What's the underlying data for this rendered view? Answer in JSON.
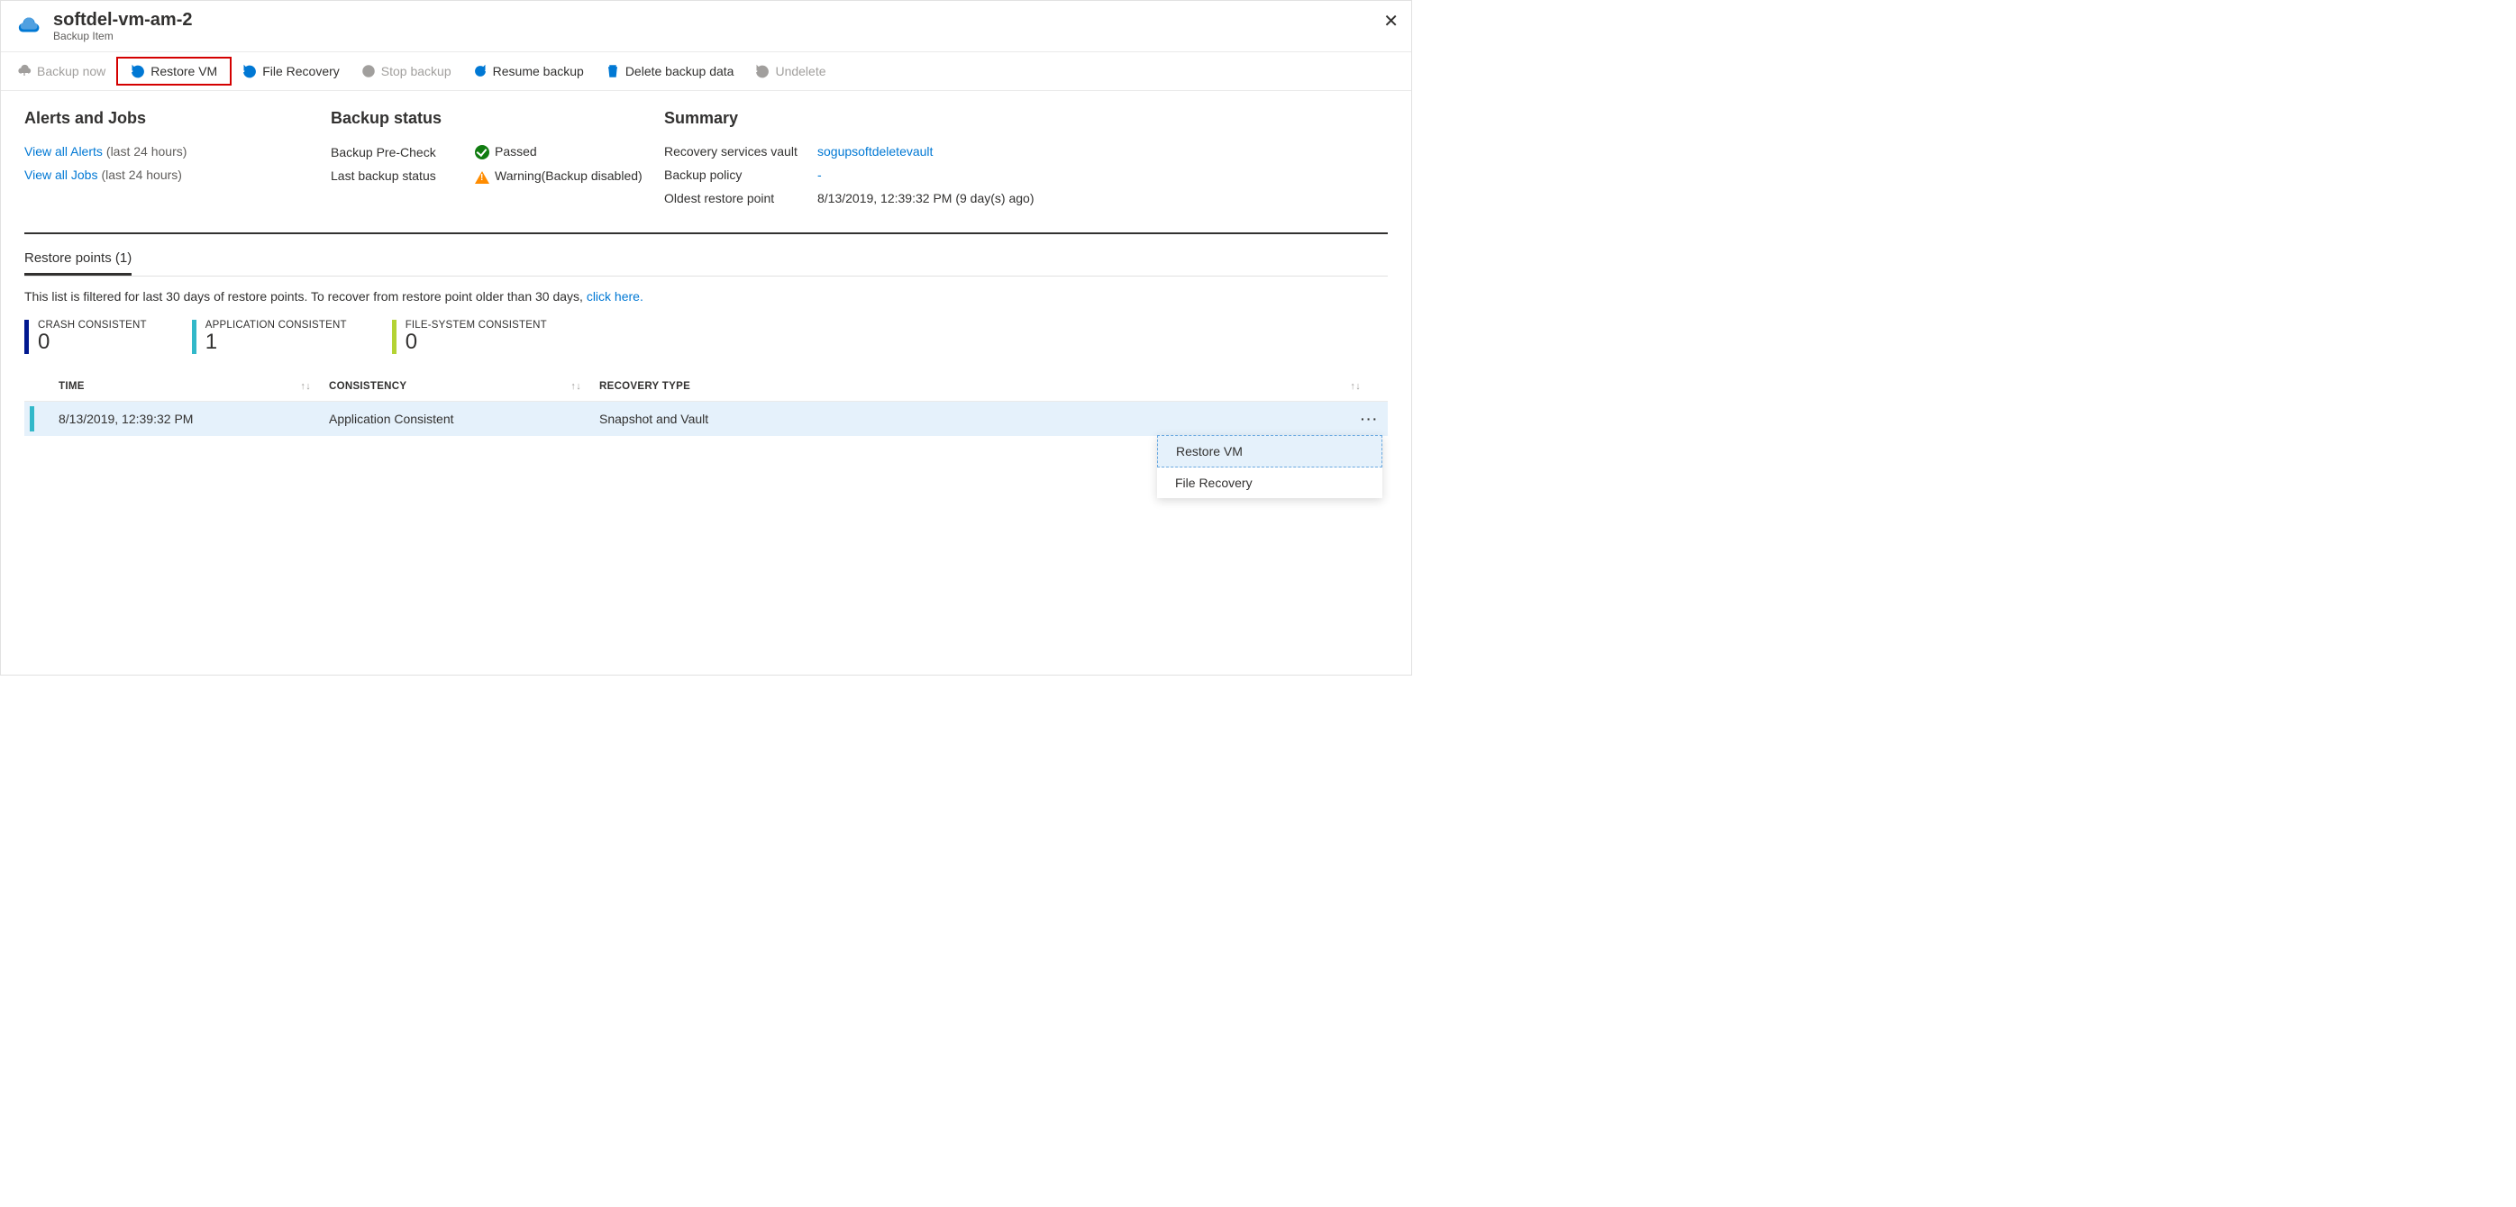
{
  "header": {
    "title": "softdel-vm-am-2",
    "subtitle": "Backup Item"
  },
  "toolbar": {
    "backup_now": "Backup now",
    "restore_vm": "Restore VM",
    "file_recovery": "File Recovery",
    "stop_backup": "Stop backup",
    "resume_backup": "Resume backup",
    "delete_backup_data": "Delete backup data",
    "undelete": "Undelete"
  },
  "sections": {
    "alerts_jobs": {
      "heading": "Alerts and Jobs",
      "view_alerts": "View all Alerts",
      "view_jobs": "View all Jobs",
      "last24": "(last 24 hours)"
    },
    "backup_status": {
      "heading": "Backup status",
      "precheck_label": "Backup Pre-Check",
      "precheck_value": "Passed",
      "last_status_label": "Last backup status",
      "last_status_value": "Warning(Backup disabled)"
    },
    "summary": {
      "heading": "Summary",
      "vault_label": "Recovery services vault",
      "vault_value": "sogupsoftdeletevault",
      "policy_label": "Backup policy",
      "policy_value": "-",
      "oldest_label": "Oldest restore point",
      "oldest_value": "8/13/2019, 12:39:32 PM (9 day(s) ago)"
    }
  },
  "tabs": {
    "restore_points": "Restore points (1)"
  },
  "filter_note": {
    "text": "This list is filtered for last 30 days of restore points. To recover from restore point older than 30 days, ",
    "link": "click here."
  },
  "stats": {
    "crash": {
      "label": "CRASH CONSISTENT",
      "value": "0"
    },
    "app": {
      "label": "APPLICATION CONSISTENT",
      "value": "1"
    },
    "fs": {
      "label": "FILE-SYSTEM CONSISTENT",
      "value": "0"
    }
  },
  "grid": {
    "headers": {
      "time": "TIME",
      "consistency": "CONSISTENCY",
      "recovery_type": "RECOVERY TYPE"
    },
    "rows": [
      {
        "time": "8/13/2019, 12:39:32 PM",
        "consistency": "Application Consistent",
        "recovery_type": "Snapshot and Vault"
      }
    ]
  },
  "context_menu": {
    "restore_vm": "Restore VM",
    "file_recovery": "File Recovery"
  }
}
